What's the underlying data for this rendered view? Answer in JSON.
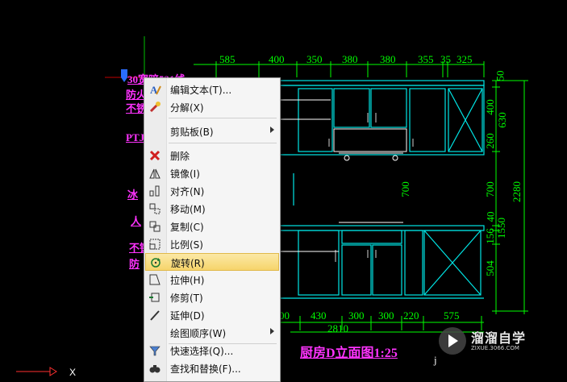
{
  "top_dimensions": [
    "585",
    "400",
    "350",
    "380",
    "380",
    "355",
    "35",
    "325"
  ],
  "bottom_dimensions": [
    "00",
    "430",
    "300",
    "300",
    "220",
    "575"
  ],
  "bottom_total": "2810",
  "right_dimensions_inner": [
    "50",
    "400",
    "260",
    "700",
    "40",
    "156",
    "504"
  ],
  "right_dimensions_outer": [
    "630",
    "1550",
    "2280"
  ],
  "center_dimension": "700",
  "left_labels": [
    "防火",
    "不锈",
    "PTJ",
    "冰",
    "人",
    "不锈",
    "防"
  ],
  "top_label_partial": "30宽暗521线",
  "drawing_title": "厨房D立面图1:25",
  "drawing_title_partial_right": "j",
  "menu": {
    "items": [
      {
        "label": "编辑文本(T)...",
        "icon": "edit-text-icon"
      },
      {
        "label": "分解(X)",
        "icon": "explode-icon"
      },
      {
        "label": "剪贴板(B)",
        "icon": "",
        "submenu": true
      },
      {
        "label": "删除",
        "icon": "delete-icon"
      },
      {
        "label": "镜像(I)",
        "icon": "mirror-icon"
      },
      {
        "label": "对齐(N)",
        "icon": "align-icon"
      },
      {
        "label": "移动(M)",
        "icon": "move-icon"
      },
      {
        "label": "复制(C)",
        "icon": "copy-icon"
      },
      {
        "label": "比例(S)",
        "icon": "scale-icon"
      },
      {
        "label": "旋转(R)",
        "icon": "rotate-icon",
        "highlighted": true
      },
      {
        "label": "拉伸(H)",
        "icon": "stretch-icon"
      },
      {
        "label": "修剪(T)",
        "icon": "trim-icon"
      },
      {
        "label": "延伸(D)",
        "icon": "extend-icon"
      },
      {
        "label": "绘图顺序(W)",
        "icon": "",
        "submenu": true
      },
      {
        "label": "快速选择(Q)...",
        "icon": "quick-select-icon"
      },
      {
        "label": "查找和替换(F)...",
        "icon": "find-replace-icon"
      }
    ]
  },
  "watermark": {
    "cn": "溜溜自学",
    "en": "ZIXUE.3066.COM"
  }
}
